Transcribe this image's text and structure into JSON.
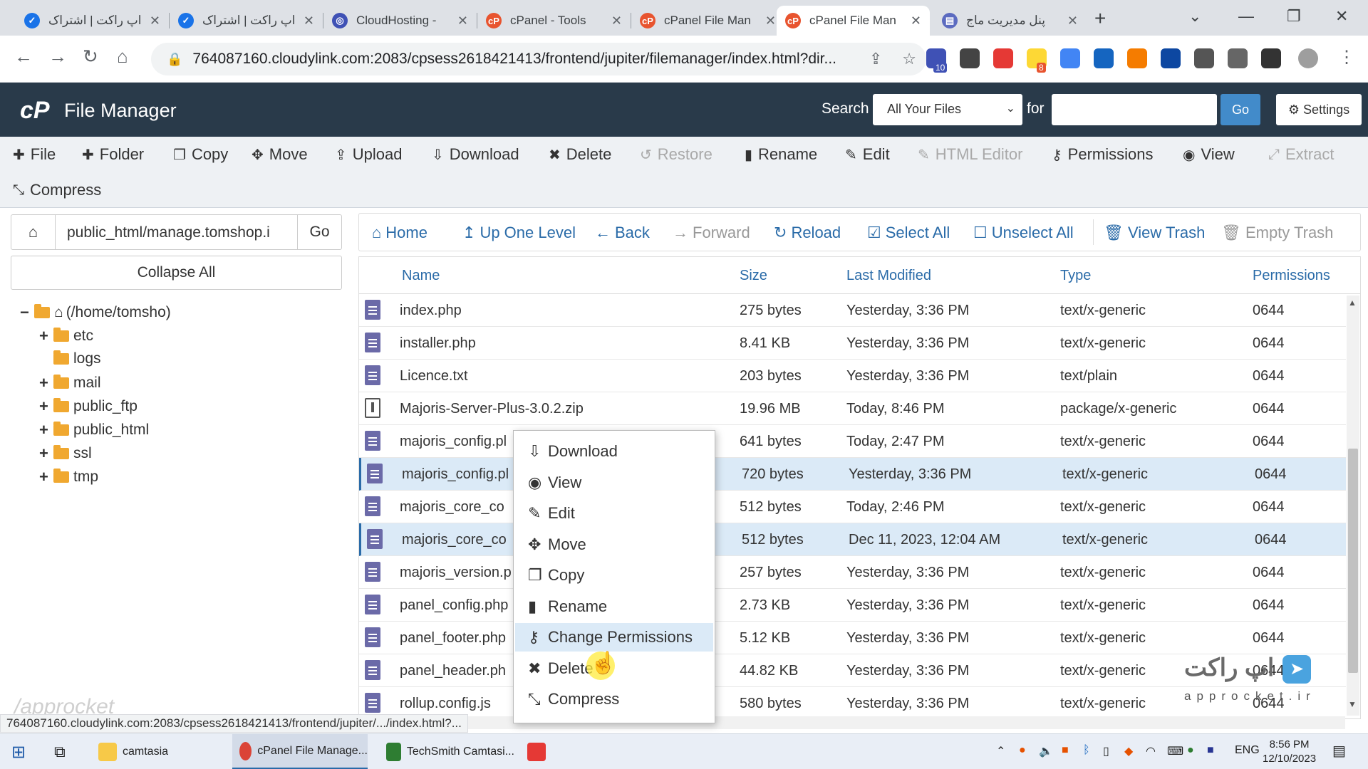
{
  "browser": {
    "tabs": [
      {
        "title": "اپ راکت | اشتراک",
        "fav_color": "#1a73e8"
      },
      {
        "title": "اپ راکت | اشتراک",
        "fav_color": "#1a73e8"
      },
      {
        "title": "CloudHosting -",
        "fav_color": "#3f51b5"
      },
      {
        "title": "cPanel - Tools",
        "fav_color": "#e8542f"
      },
      {
        "title": "cPanel File Man",
        "fav_color": "#e8542f"
      },
      {
        "title": "cPanel File Man",
        "fav_color": "#e8542f"
      },
      {
        "title": "پنل مدیریت ماج",
        "fav_color": "#5c6bc0"
      }
    ],
    "url": "764087160.cloudylink.com:2083/cpsess2618421413/frontend/jupiter/filemanager/index.html?dir...",
    "extension_badge_1": "10",
    "extension_badge_2": "8"
  },
  "header": {
    "logo": "cP",
    "title": "File Manager",
    "search_label": "Search",
    "search_scope": "All Your Files",
    "for_label": "for",
    "go_label": "Go",
    "settings_label": "Settings"
  },
  "toolbar": {
    "file": "File",
    "folder": "Folder",
    "copy": "Copy",
    "move": "Move",
    "upload": "Upload",
    "download": "Download",
    "delete": "Delete",
    "restore": "Restore",
    "rename": "Rename",
    "edit": "Edit",
    "html_editor": "HTML Editor",
    "permissions": "Permissions",
    "view": "View",
    "extract": "Extract",
    "compress": "Compress"
  },
  "sidebar": {
    "path": "public_html/manage.tomshop.i",
    "go_label": "Go",
    "collapse_label": "Collapse All",
    "root": "(/home/tomsho)",
    "folders": [
      "etc",
      "logs",
      "mail",
      "public_ftp",
      "public_html",
      "ssl",
      "tmp"
    ]
  },
  "nav": {
    "home": "Home",
    "up": "Up One Level",
    "back": "Back",
    "forward": "Forward",
    "reload": "Reload",
    "select_all": "Select All",
    "unselect_all": "Unselect All",
    "view_trash": "View Trash",
    "empty_trash": "Empty Trash"
  },
  "columns": {
    "name": "Name",
    "size": "Size",
    "modified": "Last Modified",
    "type": "Type",
    "perms": "Permissions"
  },
  "files": [
    {
      "name": "index.php",
      "size": "275 bytes",
      "modified": "Yesterday, 3:36 PM",
      "type": "text/x-generic",
      "perms": "0644"
    },
    {
      "name": "installer.php",
      "size": "8.41 KB",
      "modified": "Yesterday, 3:36 PM",
      "type": "text/x-generic",
      "perms": "0644"
    },
    {
      "name": "Licence.txt",
      "size": "203 bytes",
      "modified": "Yesterday, 3:36 PM",
      "type": "text/plain",
      "perms": "0644"
    },
    {
      "name": "Majoris-Server-Plus-3.0.2.zip",
      "size": "19.96 MB",
      "modified": "Today, 8:46 PM",
      "type": "package/x-generic",
      "perms": "0644"
    },
    {
      "name": "majoris_config.pl",
      "size": "641 bytes",
      "modified": "Today, 2:47 PM",
      "type": "text/x-generic",
      "perms": "0644"
    },
    {
      "name": "majoris_config.pl",
      "size": "720 bytes",
      "modified": "Yesterday, 3:36 PM",
      "type": "text/x-generic",
      "perms": "0644"
    },
    {
      "name": "majoris_core_co",
      "size": "512 bytes",
      "modified": "Today, 2:46 PM",
      "type": "text/x-generic",
      "perms": "0644"
    },
    {
      "name": "majoris_core_co",
      "size": "512 bytes",
      "modified": "Dec 11, 2023, 12:04 AM",
      "type": "text/x-generic",
      "perms": "0644"
    },
    {
      "name": "majoris_version.p",
      "size": "257 bytes",
      "modified": "Yesterday, 3:36 PM",
      "type": "text/x-generic",
      "perms": "0644"
    },
    {
      "name": "panel_config.php",
      "size": "2.73 KB",
      "modified": "Yesterday, 3:36 PM",
      "type": "text/x-generic",
      "perms": "0644"
    },
    {
      "name": "panel_footer.php",
      "size": "5.12 KB",
      "modified": "Yesterday, 3:36 PM",
      "type": "text/x-generic",
      "perms": "0644"
    },
    {
      "name": "panel_header.ph",
      "size": "44.82 KB",
      "modified": "Yesterday, 3:36 PM",
      "type": "text/x-generic",
      "perms": "0644"
    },
    {
      "name": "rollup.config.js",
      "size": "580 bytes",
      "modified": "Yesterday, 3:36 PM",
      "type": "text/x-generic",
      "perms": "0644"
    }
  ],
  "context_menu": {
    "download": "Download",
    "view": "View",
    "edit": "Edit",
    "move": "Move",
    "copy": "Copy",
    "rename": "Rename",
    "change_permissions": "Change Permissions",
    "delete": "Delete",
    "compress": "Compress"
  },
  "statusbar": "764087160.cloudylink.com:2083/cpsess2618421413/frontend/jupiter/.../index.html?...",
  "watermark": {
    "left": "/approcket",
    "right": "اپ راکت",
    "right_sub": "approcket.ir"
  },
  "taskbar": {
    "app1": "camtasia",
    "app2": "cPanel File Manage...",
    "app3": "TechSmith Camtasi...",
    "lang": "ENG",
    "time": "8:56 PM",
    "date": "12/10/2023"
  }
}
